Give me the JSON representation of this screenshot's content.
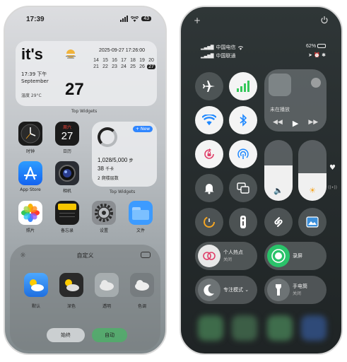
{
  "left": {
    "status_time": "17:39",
    "battery": "43",
    "widget": {
      "headline": "it's",
      "time_line": "17:39 下午",
      "month": "September",
      "temp": "温度 29°C",
      "day": "27",
      "datetime": "2025-09-27 17:26:00",
      "calendar": [
        "14",
        "15",
        "16",
        "17",
        "18",
        "19",
        "20",
        "21",
        "22",
        "23",
        "24",
        "25",
        "26",
        "27"
      ],
      "caption": "Top Widgets"
    },
    "apps": {
      "clock": "时钟",
      "calendar": "日历",
      "calendar_weekday": "周六",
      "calendar_day": "27",
      "appstore": "App Store",
      "camera": "相机",
      "photos": "照片",
      "notes": "备忘录",
      "settings": "设置",
      "files": "文件"
    },
    "step_widget": {
      "badge": "+ New",
      "steps": "1,028/5,000",
      "steps_unit": "步",
      "kcal": "38",
      "kcal_unit": "千卡",
      "climb": "2 爬楼层数",
      "caption": "Top Widgets"
    },
    "panel": {
      "title": "自定义",
      "options": [
        "默认",
        "深色",
        "透明",
        "色调"
      ],
      "bottom_left": "始终",
      "bottom_right": "自动"
    }
  },
  "right": {
    "carrier1": "中国电信",
    "carrier2": "中国联通",
    "battery": "62%",
    "now_playing": "未在播放",
    "hotspot_title": "个人热点",
    "hotspot_sub": "关闭",
    "record": "录屏",
    "focus": "专注模式",
    "flashlight_title": "手电筒",
    "flashlight_sub": "关闭"
  },
  "colors": {
    "cellular_green": "#34c759",
    "wifi_blue": "#1e88ff",
    "record_green": "#2ac36a",
    "hotspot_red": "#e0406a"
  }
}
